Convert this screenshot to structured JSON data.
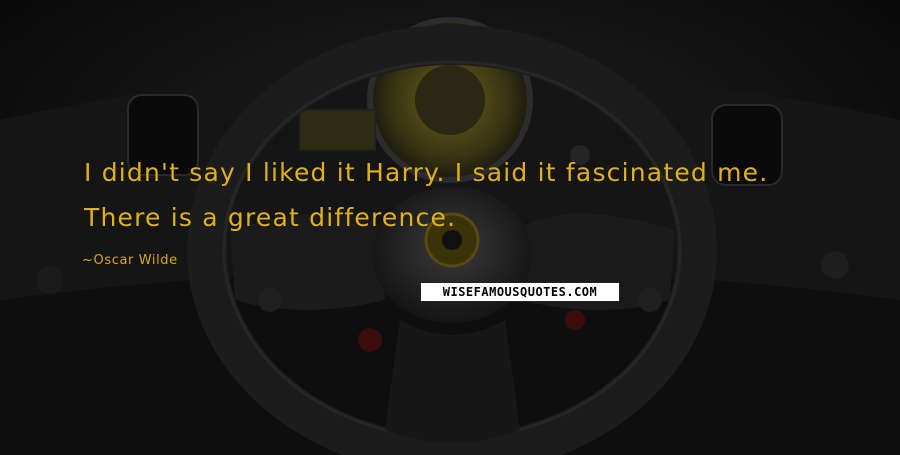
{
  "quote": {
    "text": "I didn't say I liked it Harry. I said it fascinated me. There is a great difference.",
    "author": "Oscar Wilde"
  },
  "watermark": {
    "text": "WISEFAMOUSQUOTES.COM"
  },
  "background": {
    "description_icon": "steering-wheel-image",
    "colors": {
      "text": "#e0b018",
      "background": "#111111"
    }
  }
}
